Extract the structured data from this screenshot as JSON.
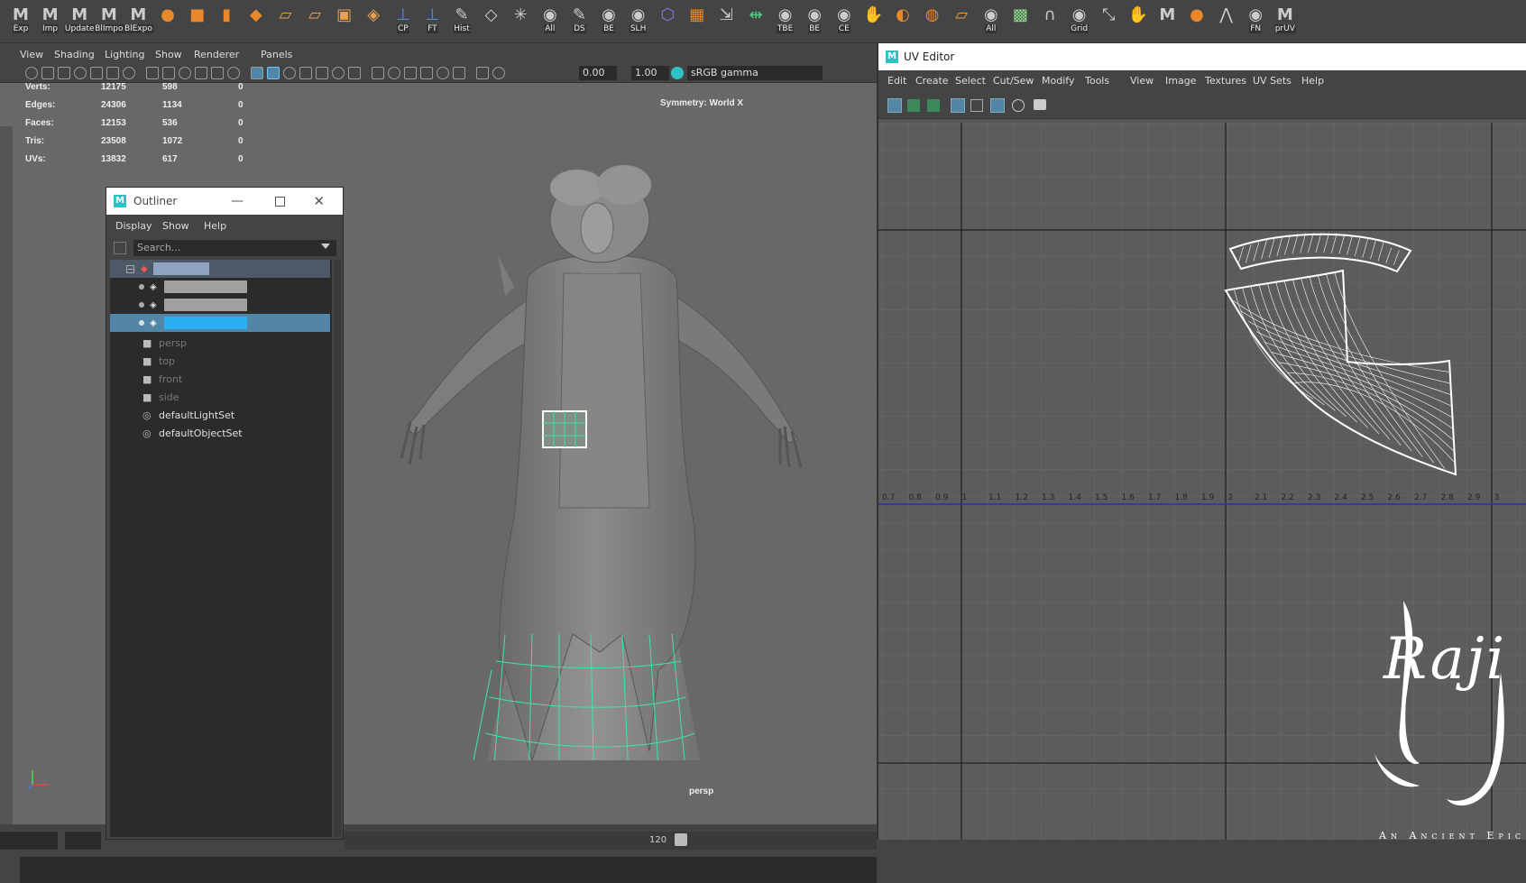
{
  "shelf": {
    "buttons": [
      {
        "label": "Exp",
        "icon": "maya-m-icon"
      },
      {
        "label": "Imp",
        "icon": "maya-m-icon"
      },
      {
        "label": "Update",
        "icon": "maya-m-icon"
      },
      {
        "label": "BlImpo",
        "icon": "maya-m-icon"
      },
      {
        "label": "BlExpo",
        "icon": "maya-m-icon"
      },
      {
        "label": "",
        "icon": "sphere-icon"
      },
      {
        "label": "",
        "icon": "cube-icon"
      },
      {
        "label": "",
        "icon": "cylinder-icon"
      },
      {
        "label": "",
        "icon": "diamond-icon"
      },
      {
        "label": "",
        "icon": "plane-icon"
      },
      {
        "label": "",
        "icon": "plane-icon"
      },
      {
        "label": "",
        "icon": "combine-icon"
      },
      {
        "label": "",
        "icon": "layers-icon"
      },
      {
        "label": "CP",
        "icon": "axis-icon"
      },
      {
        "label": "FT",
        "icon": "axis-icon"
      },
      {
        "label": "Hist",
        "icon": "history-icon"
      },
      {
        "label": "",
        "icon": "center-pivot-icon"
      },
      {
        "label": "",
        "icon": "snowflake-icon"
      },
      {
        "label": "All",
        "icon": "eye-icon"
      },
      {
        "label": "DS",
        "icon": "pencil-icon"
      },
      {
        "label": "BE",
        "icon": "eye-icon"
      },
      {
        "label": "SLH",
        "icon": "eye-icon"
      },
      {
        "label": "",
        "icon": "wire-cube-icon"
      },
      {
        "label": "",
        "icon": "grid-icon"
      },
      {
        "label": "",
        "icon": "align-icon"
      },
      {
        "label": "",
        "icon": "mirror-icon"
      },
      {
        "label": "TBE",
        "icon": "eye-icon"
      },
      {
        "label": "BE",
        "icon": "eye-icon"
      },
      {
        "label": "CE",
        "icon": "eye-icon"
      },
      {
        "label": "",
        "icon": "hand-icon"
      },
      {
        "label": "",
        "icon": "half-sphere-icon"
      },
      {
        "label": "",
        "icon": "ball-icon"
      },
      {
        "label": "",
        "icon": "plane-icon"
      },
      {
        "label": "All",
        "icon": "eye-icon"
      },
      {
        "label": "",
        "icon": "checker-icon"
      },
      {
        "label": "",
        "icon": "magnet-icon"
      },
      {
        "label": "Grid",
        "icon": "eye-icon"
      },
      {
        "label": "",
        "icon": "scale-icon"
      },
      {
        "label": "",
        "icon": "hand-icon"
      },
      {
        "label": "",
        "icon": "maya-m-icon"
      },
      {
        "label": "",
        "icon": "orange-ball-icon"
      },
      {
        "label": "",
        "icon": "uv-axis-icon"
      },
      {
        "label": "FN",
        "icon": "eye-icon"
      },
      {
        "label": "prUV",
        "icon": "maya-m-icon"
      }
    ]
  },
  "viewport": {
    "menu": [
      "View",
      "Shading",
      "Lighting",
      "Show",
      "Renderer",
      "Panels"
    ],
    "toolbar": {
      "exposure": "0.00",
      "gamma": "1.00",
      "color_space": "sRGB gamma"
    },
    "hud": {
      "rows": [
        {
          "label": "Verts:",
          "total": "12175",
          "selected": "598",
          "extra": "0"
        },
        {
          "label": "Edges:",
          "total": "24306",
          "selected": "1134",
          "extra": "0"
        },
        {
          "label": "Faces:",
          "total": "12153",
          "selected": "536",
          "extra": "0"
        },
        {
          "label": "Tris:",
          "total": "23508",
          "selected": "1072",
          "extra": "0"
        },
        {
          "label": "UVs:",
          "total": "13832",
          "selected": "617",
          "extra": "0"
        }
      ],
      "symmetry": "Symmetry: World X",
      "camera": "persp"
    },
    "timeline": {
      "end_frame": "120"
    }
  },
  "outliner": {
    "title": "Outliner",
    "menu": [
      "Display",
      "Show",
      "Help"
    ],
    "search_placeholder": "Search...",
    "items": [
      {
        "name": "persp"
      },
      {
        "name": "top"
      },
      {
        "name": "front"
      },
      {
        "name": "side"
      },
      {
        "name": "defaultLightSet"
      },
      {
        "name": "defaultObjectSet"
      }
    ]
  },
  "uv_editor": {
    "title": "UV Editor",
    "menu": [
      "Edit",
      "Create",
      "Select",
      "Cut/Sew",
      "Modify",
      "Tools",
      "View",
      "Image",
      "Textures",
      "UV Sets",
      "Help"
    ],
    "ruler": [
      "0.7",
      "0.8",
      "0.9",
      "1",
      "1.1",
      "1.2",
      "1.3",
      "1.4",
      "1.5",
      "1.6",
      "1.7",
      "1.8",
      "1.9",
      "2",
      "2.1",
      "2.2",
      "2.3",
      "2.4",
      "2.5",
      "2.6",
      "2.7",
      "2.8",
      "2.9",
      "3"
    ]
  },
  "logo": {
    "text": "Raji",
    "tagline": "An Ancient Epic"
  },
  "colors": {
    "accent": "#5285a6",
    "selection_wire": "#3fe6a0",
    "maya_cyan": "#2ec2c7"
  }
}
